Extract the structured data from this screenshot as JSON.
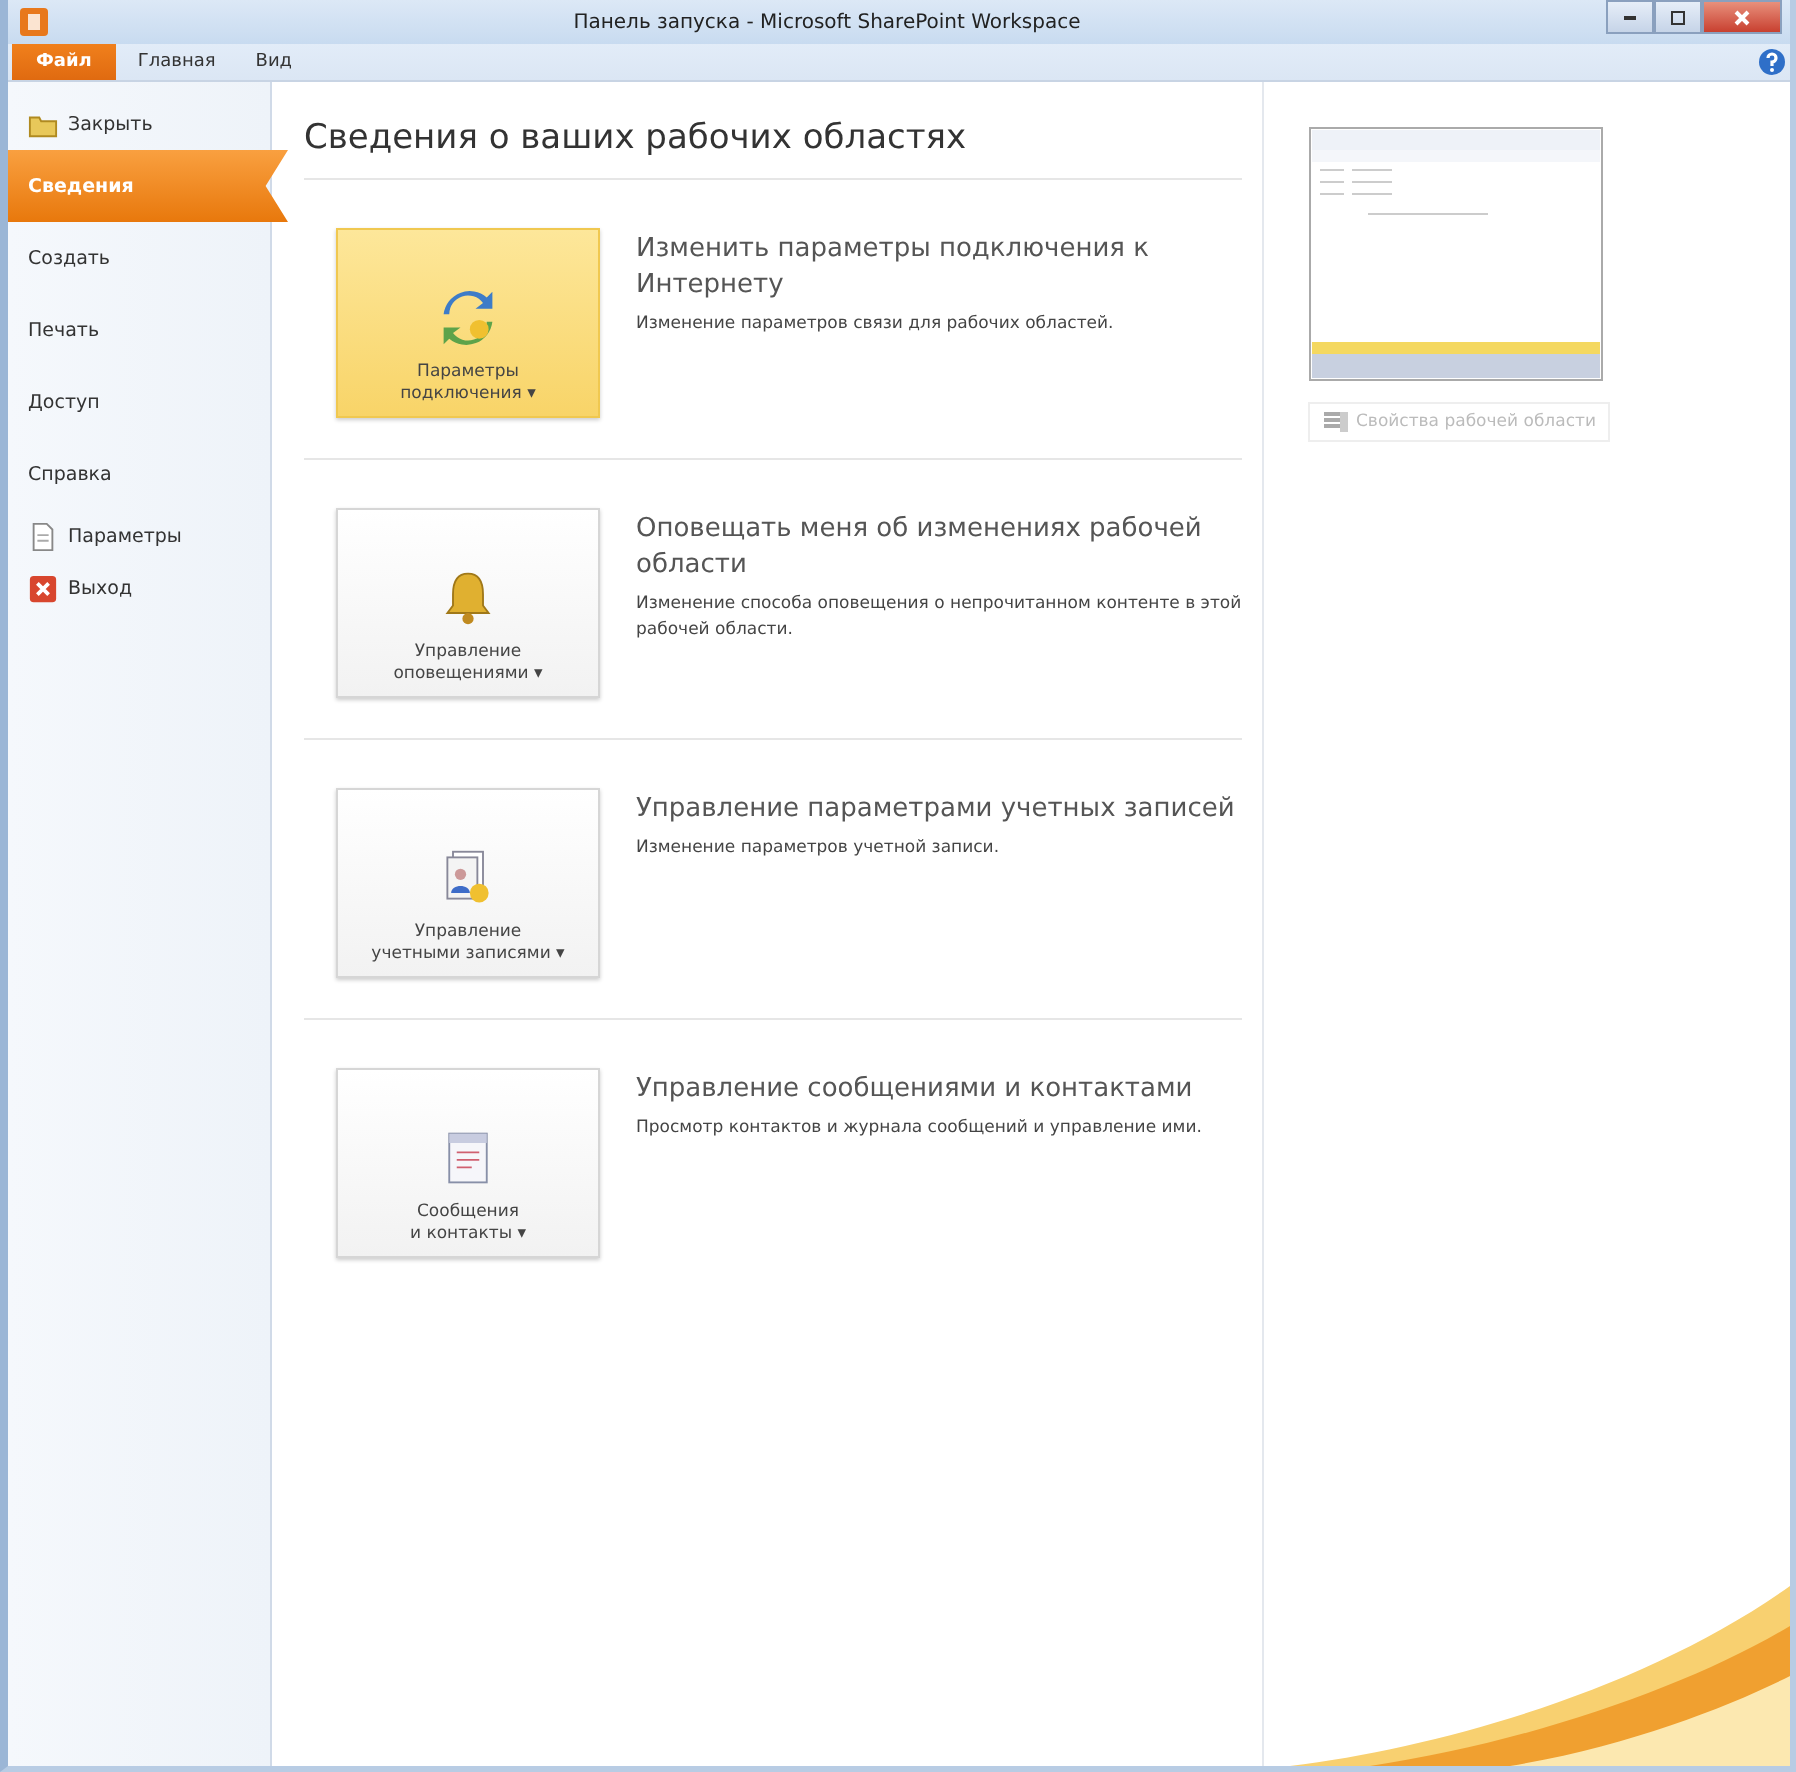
{
  "window": {
    "title": "Панель запуска - Microsoft SharePoint Workspace"
  },
  "ribbon_tabs": [
    {
      "label": "Файл",
      "selected": true
    },
    {
      "label": "Главная",
      "selected": false
    },
    {
      "label": "Вид",
      "selected": false
    }
  ],
  "sidebar": {
    "items": [
      {
        "label": "Закрыть",
        "kind": "command",
        "selected": false
      },
      {
        "label": "Сведения",
        "kind": "page",
        "selected": true
      },
      {
        "label": "Создать",
        "kind": "page",
        "selected": false
      },
      {
        "label": "Печать",
        "kind": "page",
        "selected": false
      },
      {
        "label": "Доступ",
        "kind": "page",
        "selected": false
      },
      {
        "label": "Справка",
        "kind": "page",
        "selected": false
      },
      {
        "label": "Параметры",
        "kind": "command",
        "selected": false
      },
      {
        "label": "Выход",
        "kind": "command",
        "selected": false
      }
    ]
  },
  "heading": "Сведения о ваших рабочих областях",
  "sections": [
    {
      "button": [
        "Параметры",
        "подключения ▾"
      ],
      "highlighted": true,
      "title": "Изменить параметры подключения к Интернету",
      "description": "Изменение параметров связи для рабочих областей."
    },
    {
      "button": [
        "Управление",
        "оповещениями ▾"
      ],
      "highlighted": false,
      "title": "Оповещать меня об изменениях рабочей области",
      "description": "Изменение способа оповещения о непрочитанном контенте в этой рабочей области."
    },
    {
      "button": [
        "Управление",
        "учетными записями ▾"
      ],
      "highlighted": false,
      "title": "Управление параметрами учетных записей",
      "description": "Изменение параметров учетной записи."
    },
    {
      "button": [
        "Сообщения",
        "и контакты ▾"
      ],
      "highlighted": false,
      "title": "Управление сообщениями и контактами",
      "description": "Просмотр контактов и журнала сообщений и управление ими."
    }
  ],
  "preview": {
    "button": "Свойства рабочей области",
    "disabled": true
  }
}
